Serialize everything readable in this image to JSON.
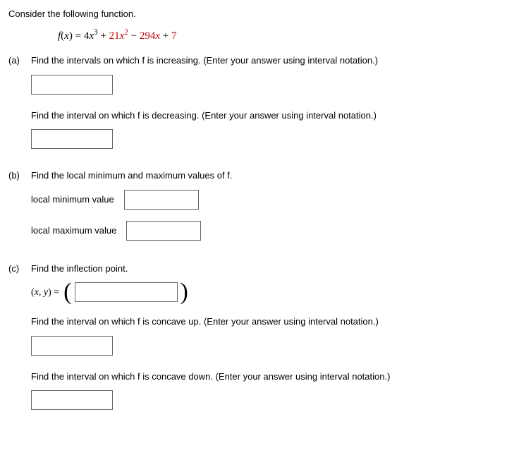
{
  "intro": "Consider the following function.",
  "formula": {
    "lhs_f": "f",
    "lhs_x": "x",
    "c1": "4",
    "e1": "3",
    "c2": "21",
    "e2": "2",
    "c3": "294",
    "c4": "7",
    "var": "x"
  },
  "parts": {
    "a": {
      "label": "(a)",
      "q1": "Find the intervals on which f is increasing. (Enter your answer using interval notation.)",
      "q2": "Find the interval on which f is decreasing. (Enter your answer using interval notation.)"
    },
    "b": {
      "label": "(b)",
      "q": "Find the local minimum and maximum values of f.",
      "min_label": "local minimum value",
      "max_label": "local maximum value"
    },
    "c": {
      "label": "(c)",
      "q1": "Find the inflection point.",
      "xy_label": "(x, y) =",
      "q2": "Find the interval on which f is concave up. (Enter your answer using interval notation.)",
      "q3": "Find the interval on which f is concave down. (Enter your answer using interval notation.)"
    }
  }
}
